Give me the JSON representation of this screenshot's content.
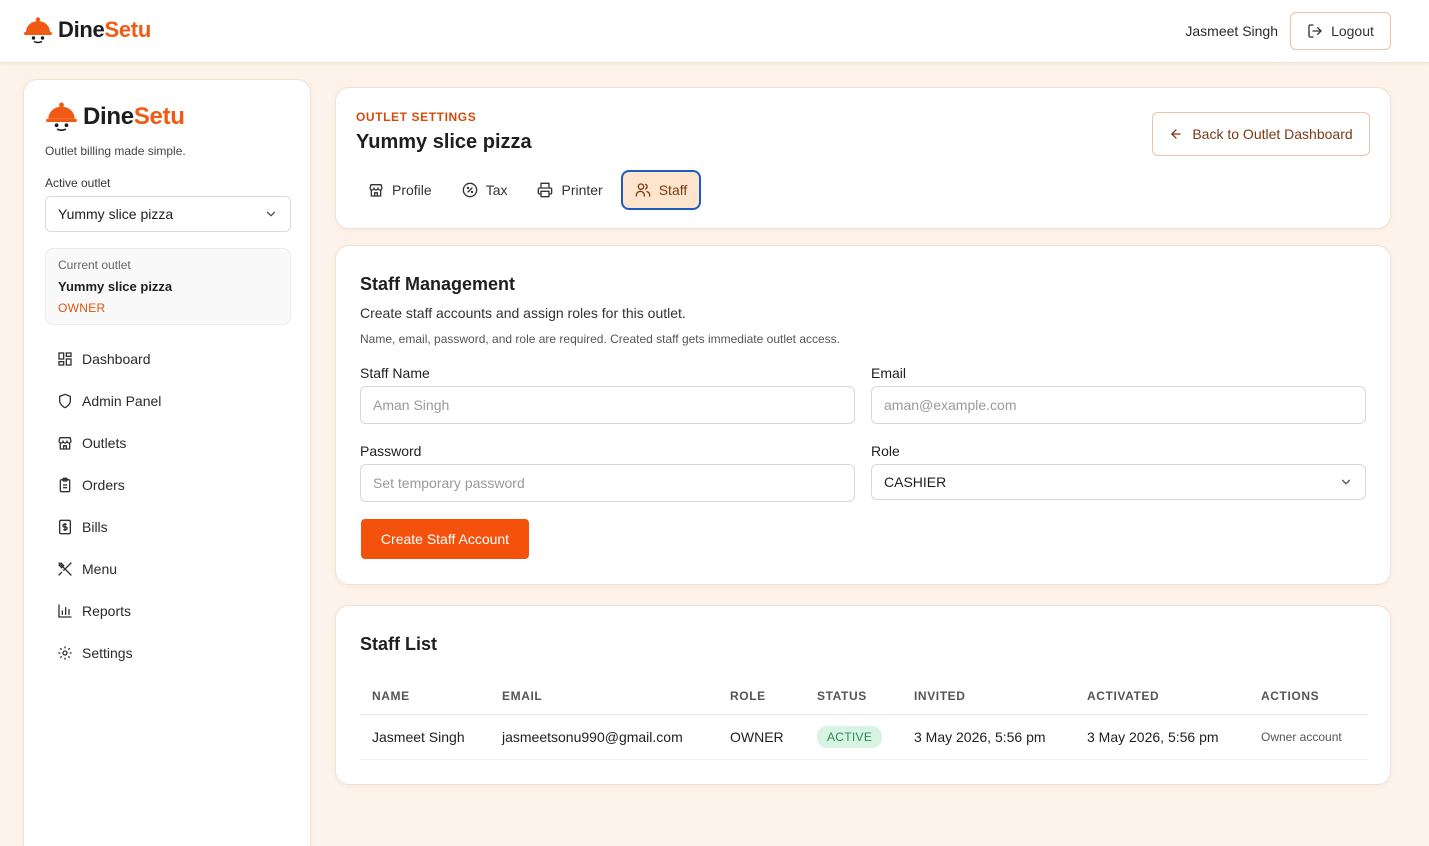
{
  "brand": {
    "name_part1": "Dine",
    "name_part2": "Setu",
    "tagline": "Outlet billing made simple.",
    "accent": "#f05a14"
  },
  "topbar": {
    "user_name": "Jasmeet Singh",
    "logout_label": "Logout"
  },
  "sidebar": {
    "active_outlet_label": "Active outlet",
    "active_outlet_value": "Yummy slice pizza",
    "current_outlet": {
      "label": "Current outlet",
      "name": "Yummy slice pizza",
      "role": "OWNER"
    },
    "items": [
      {
        "label": "Dashboard",
        "icon": "dashboard-icon"
      },
      {
        "label": "Admin Panel",
        "icon": "shield-icon"
      },
      {
        "label": "Outlets",
        "icon": "store-icon"
      },
      {
        "label": "Orders",
        "icon": "clipboard-icon"
      },
      {
        "label": "Bills",
        "icon": "receipt-icon"
      },
      {
        "label": "Menu",
        "icon": "utensils-icon"
      },
      {
        "label": "Reports",
        "icon": "bar-chart-icon"
      },
      {
        "label": "Settings",
        "icon": "gear-icon"
      }
    ]
  },
  "header": {
    "eyebrow": "OUTLET SETTINGS",
    "title": "Yummy slice pizza",
    "back_label": "Back to Outlet Dashboard",
    "tabs": [
      {
        "label": "Profile",
        "icon": "store-icon"
      },
      {
        "label": "Tax",
        "icon": "percent-icon"
      },
      {
        "label": "Printer",
        "icon": "printer-icon"
      },
      {
        "label": "Staff",
        "icon": "users-icon",
        "active": true
      }
    ]
  },
  "staff_form": {
    "title": "Staff Management",
    "description": "Create staff accounts and assign roles for this outlet.",
    "note": "Name, email, password, and role are required. Created staff gets immediate outlet access.",
    "name_label": "Staff Name",
    "name_placeholder": "Aman Singh",
    "email_label": "Email",
    "email_placeholder": "aman@example.com",
    "password_label": "Password",
    "password_placeholder": "Set temporary password",
    "role_label": "Role",
    "role_value": "CASHIER",
    "submit_label": "Create Staff Account"
  },
  "staff_list": {
    "title": "Staff List",
    "columns": [
      "NAME",
      "EMAIL",
      "ROLE",
      "STATUS",
      "INVITED",
      "ACTIVATED",
      "ACTIONS"
    ],
    "rows": [
      {
        "name": "Jasmeet Singh",
        "email": "jasmeetsonu990@gmail.com",
        "role": "OWNER",
        "status": "ACTIVE",
        "invited": "3 May 2026, 5:56 pm",
        "activated": "3 May 2026, 5:56 pm",
        "action": "Owner account"
      }
    ]
  }
}
